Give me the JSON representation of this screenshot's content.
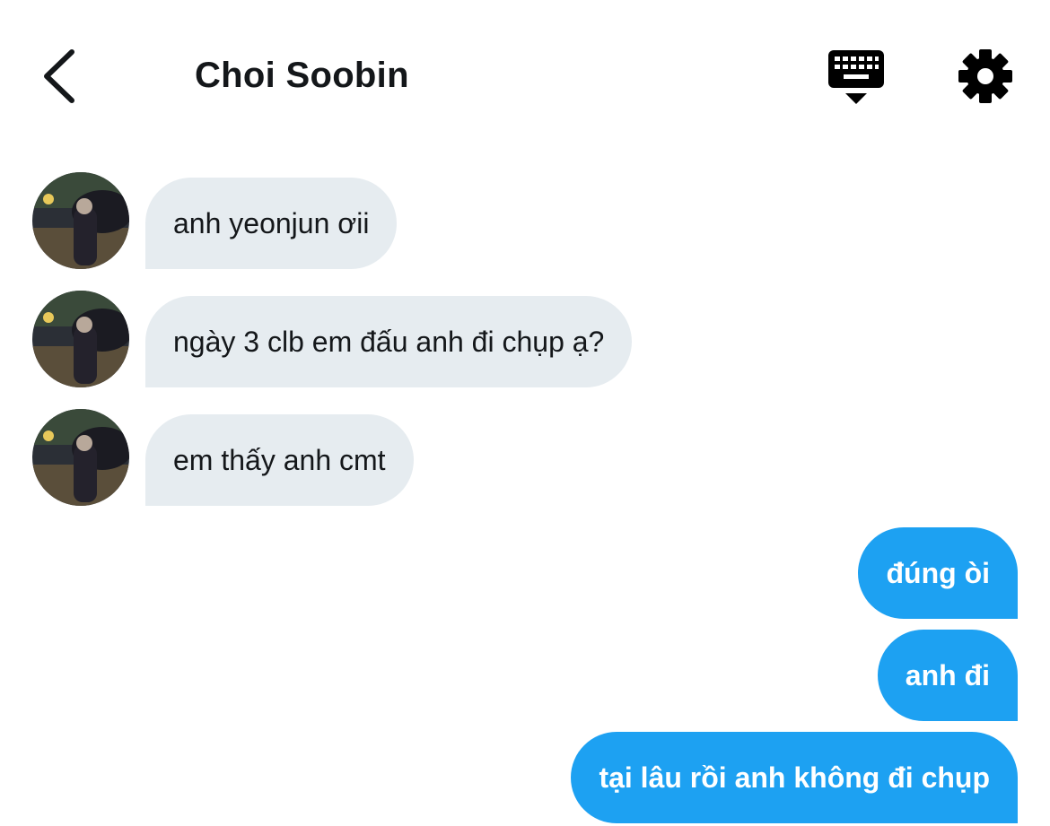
{
  "header": {
    "title": "Choi Soobin",
    "back_icon": "chevron-left-icon",
    "keyboard_icon": "keyboard-hide-icon",
    "settings_icon": "gear-icon"
  },
  "messages": [
    {
      "direction": "in",
      "text": "anh yeonjun ơii"
    },
    {
      "direction": "in",
      "text": "ngày 3 clb em đấu anh đi chụp ạ?"
    },
    {
      "direction": "in",
      "text": "em thấy anh cmt"
    },
    {
      "direction": "out",
      "text": "đúng òi"
    },
    {
      "direction": "out",
      "text": "anh đi"
    },
    {
      "direction": "out",
      "text": "tại lâu rồi anh không đi chụp"
    }
  ],
  "colors": {
    "incoming_bubble": "#e6ecf0",
    "outgoing_bubble": "#1da1f2",
    "text": "#14171a",
    "background": "#ffffff"
  }
}
